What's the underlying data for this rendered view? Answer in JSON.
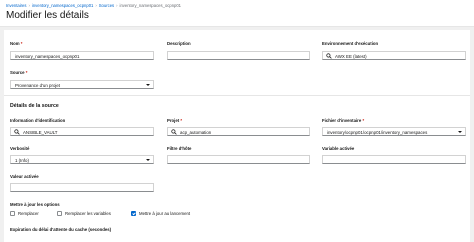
{
  "breadcrumb": {
    "items": [
      "Inventaires",
      "inventory_namespaces_ocpnp01",
      "Sources",
      "inventory_namespaces_ocpnp01"
    ]
  },
  "page": {
    "title": "Modifier les détails"
  },
  "form": {
    "name": {
      "label": "Nom",
      "required_mark": "*",
      "value": "inventory_namespaces_ocpnp01"
    },
    "description": {
      "label": "Description",
      "value": ""
    },
    "environment": {
      "label": "Environnement d'exécution",
      "value": "AWX EE (latest)",
      "icon": "search-icon"
    },
    "source": {
      "label": "Source",
      "required_mark": "*",
      "value": "Provenance d'un projet"
    }
  },
  "source_details": {
    "title": "Détails de la source",
    "credential": {
      "label": "Information d'identification",
      "value": "ANSIBLE_VAULT",
      "icon": "search-icon"
    },
    "project": {
      "label": "Projet",
      "required_mark": "*",
      "value": "acp_automation",
      "icon": "search-icon"
    },
    "inventory_file": {
      "label": "Fichier d'inventaire",
      "required_mark": "*",
      "value": "inventory/ocpnp01/ocpnp01/inventory_namespaces"
    },
    "verbosity": {
      "label": "Verbosité",
      "value": "1 (Info)"
    },
    "host_filter": {
      "label": "Filtre d'hôte",
      "value": ""
    },
    "enabled_variable": {
      "label": "Variable activée",
      "value": ""
    },
    "enabled_value": {
      "label": "Valeur activée",
      "value": ""
    },
    "update_options": {
      "label": "Mettre à jour les options",
      "options": [
        {
          "label": "Remplacer",
          "checked": false
        },
        {
          "label": "Remplacer les variables",
          "checked": false
        },
        {
          "label": "Mettre à jour au lancement",
          "checked": true
        }
      ]
    },
    "cache_timeout": {
      "label": "Expiration du délai d'attente du cache (secondes)"
    }
  },
  "colors": {
    "link": "#0066cc",
    "accent": "#0066cc",
    "background": "#f0f0f0"
  }
}
